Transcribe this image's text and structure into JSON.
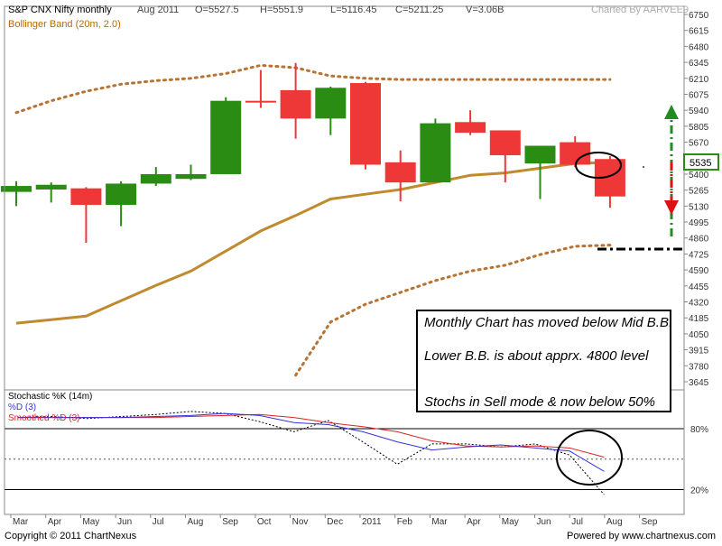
{
  "header": {
    "title": "S&P CNX Nifty monthly",
    "period": "Aug 2011",
    "open": "O=5527.5",
    "high": "H=5551.9",
    "low": "L=5116.45",
    "close": "C=5211.25",
    "volume": "V=3.06B",
    "charted_by": "Charted By AARVEE9"
  },
  "indicator_label": "Bollinger Band (20m, 2.0)",
  "stoch_labels": {
    "k": "Stochastic %K (14m)",
    "d": "%D (3)",
    "sd": "Smoothed %D (3)"
  },
  "annotation": {
    "line1": "Monthly Chart has moved below Mid B.B.",
    "line2": "Lower B.B. is about apprx. 4800 level",
    "line3": "Stochs in Sell mode & now below 50%"
  },
  "current_price_label": "5535",
  "footer": {
    "copyright": "Copyright © 2011 ChartNexus",
    "powered": "Powered by www.chartnexus.com"
  },
  "colors": {
    "up": "#2a8c13",
    "down": "#ee3737",
    "bb_mid": "#c08a2e",
    "bb_band": "#b87333",
    "k_line": "#000000",
    "d_line": "#3333dd",
    "sd_line": "#dd2222",
    "arrow_up": "#228b22",
    "arrow_down": "#dd1111"
  },
  "chart_data": [
    {
      "type": "candlestick",
      "y_ticks": [
        "6750",
        "6615",
        "6480",
        "6345",
        "6210",
        "6075",
        "5940",
        "5805",
        "5670",
        "5535",
        "5400",
        "5265",
        "5130",
        "4995",
        "4860",
        "4725",
        "4590",
        "4455",
        "4320",
        "4185",
        "4050",
        "3915",
        "3780",
        "3645"
      ],
      "ylim": [
        3645,
        6750
      ],
      "x_labels": [
        "Mar",
        "Apr",
        "May",
        "Jun",
        "Jul",
        "Aug",
        "Sep",
        "Oct",
        "Nov",
        "Dec",
        "2011",
        "Feb",
        "Mar",
        "Apr",
        "May",
        "Jun",
        "Jul",
        "Aug",
        "Sep"
      ],
      "candles": [
        {
          "o": 5250,
          "h": 5340,
          "l": 5130,
          "c": 5300
        },
        {
          "o": 5270,
          "h": 5330,
          "l": 5160,
          "c": 5310
        },
        {
          "o": 5280,
          "h": 5290,
          "l": 4820,
          "c": 5140
        },
        {
          "o": 5140,
          "h": 5340,
          "l": 4960,
          "c": 5320
        },
        {
          "o": 5320,
          "h": 5460,
          "l": 5300,
          "c": 5400
        },
        {
          "o": 5360,
          "h": 5480,
          "l": 5350,
          "c": 5400
        },
        {
          "o": 5400,
          "h": 6050,
          "l": 5400,
          "c": 6020
        },
        {
          "o": 6020,
          "h": 6280,
          "l": 5960,
          "c": 6010
        },
        {
          "o": 6110,
          "h": 6340,
          "l": 5700,
          "c": 5870
        },
        {
          "o": 5870,
          "h": 6140,
          "l": 5730,
          "c": 6130
        },
        {
          "o": 6170,
          "h": 6180,
          "l": 5440,
          "c": 5480
        },
        {
          "o": 5500,
          "h": 5600,
          "l": 5170,
          "c": 5330
        },
        {
          "o": 5330,
          "h": 5870,
          "l": 5330,
          "c": 5830
        },
        {
          "o": 5840,
          "h": 5940,
          "l": 5730,
          "c": 5750
        },
        {
          "o": 5770,
          "h": 5770,
          "l": 5330,
          "c": 5560
        },
        {
          "o": 5490,
          "h": 5630,
          "l": 5190,
          "c": 5640
        },
        {
          "o": 5670,
          "h": 5720,
          "l": 5460,
          "c": 5480
        },
        {
          "o": 5527.5,
          "h": 5551.9,
          "l": 5116.45,
          "c": 5211.25
        }
      ],
      "bollinger_mid": [
        4140,
        4170,
        4200,
        4330,
        4460,
        4580,
        4750,
        4920,
        5050,
        5190,
        5230,
        5270,
        5330,
        5390,
        5410,
        5450,
        5490,
        5500
      ],
      "bollinger_upper": [
        5920,
        6020,
        6100,
        6160,
        6190,
        6210,
        6250,
        6320,
        6300,
        6230,
        6210,
        6200,
        6200,
        6200,
        6200,
        6200,
        6200,
        6200
      ],
      "bollinger_lower": [
        null,
        null,
        null,
        null,
        null,
        null,
        null,
        null,
        3700,
        4150,
        4300,
        4400,
        4500,
        4580,
        4630,
        4720,
        4790,
        4800
      ],
      "annotated_levels": {
        "lower_bb_target": 4800
      }
    },
    {
      "type": "line",
      "title": "Stochastic %K (14m)",
      "ylim": [
        0,
        100
      ],
      "y_ticks": [
        "80%",
        "20%"
      ],
      "series": [
        {
          "name": "Stochastic %K (14m)",
          "values": [
            91,
            92,
            90,
            92,
            94,
            97,
            95,
            87,
            77,
            88,
            67,
            45,
            65,
            65,
            62,
            65,
            54,
            15
          ]
        },
        {
          "name": "%D (3)",
          "values": [
            91,
            91,
            91,
            91,
            92,
            93,
            95,
            93,
            86,
            84,
            77,
            67,
            59,
            62,
            64,
            61,
            58,
            38
          ]
        },
        {
          "name": "Smoothed %D (3)",
          "values": [
            91,
            91,
            91,
            91,
            91,
            92,
            93,
            94,
            91,
            86,
            82,
            77,
            68,
            63,
            62,
            63,
            61,
            52
          ]
        }
      ]
    }
  ]
}
